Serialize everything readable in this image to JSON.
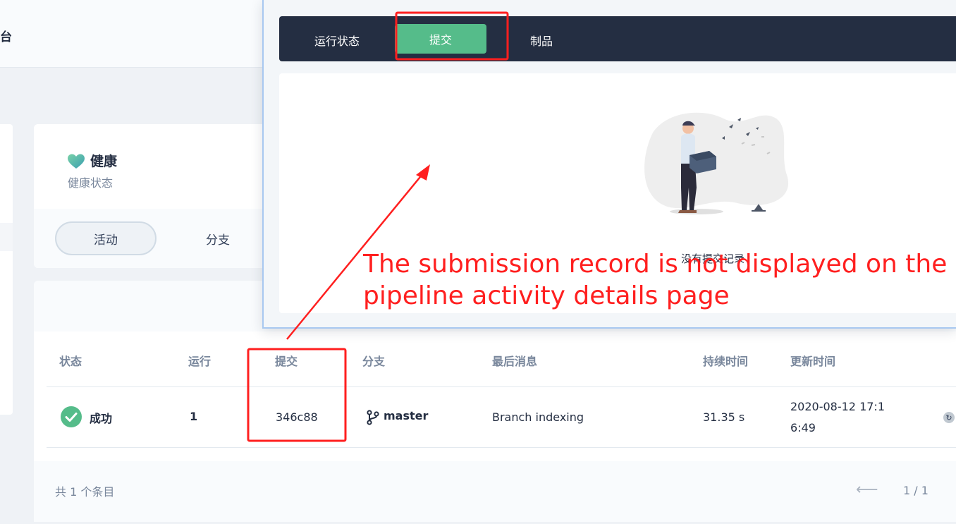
{
  "header": {
    "title_fragment": "台"
  },
  "health": {
    "title": "健康",
    "subtitle": "健康状态",
    "tabs": [
      "活动",
      "分支"
    ]
  },
  "table": {
    "columns": [
      "状态",
      "运行",
      "提交",
      "分支",
      "最后消息",
      "持续时间",
      "更新时间"
    ],
    "rows": [
      {
        "status": "成功",
        "run": "1",
        "commit": "346c88",
        "branch": "master",
        "message": "Branch indexing",
        "duration": "31.35 s",
        "updated_line1": "2020-08-12 17:1",
        "updated_line2": "6:49"
      }
    ],
    "total": "共 1 个条目",
    "pager": "1 / 1",
    "pager_prev": "⟵"
  },
  "modal": {
    "tabs": [
      "运行状态",
      "提交",
      "制品"
    ],
    "active_tab": "提交",
    "empty_text": "没有提交记录"
  },
  "annotation": {
    "text_line1": "The submission record is not displayed on the",
    "text_line2": "pipeline activity details page",
    "color": "#ff1f1f"
  },
  "colors": {
    "accent": "#55bc8a",
    "dark": "#242e42",
    "muted": "#79879c"
  }
}
